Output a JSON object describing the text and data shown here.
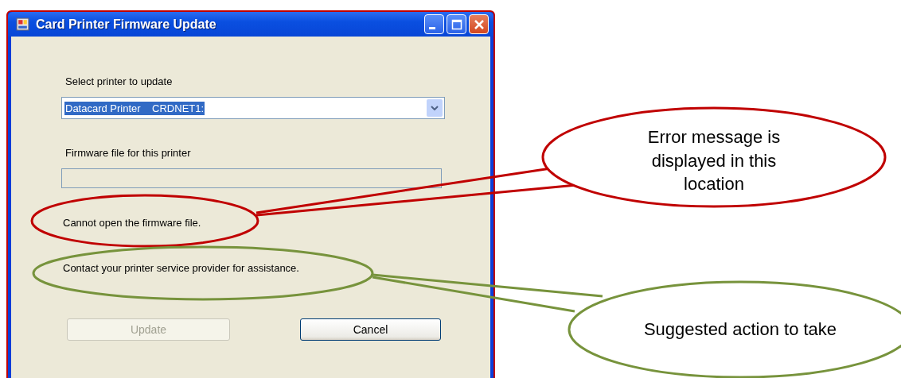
{
  "window": {
    "title": "Card Printer Firmware Update"
  },
  "printer": {
    "label": "Select printer to update",
    "value": "Datacard Printer    CRDNET1:",
    "highlighted": true
  },
  "firmware": {
    "label": "Firmware file for this printer"
  },
  "error_message": "Cannot open the firmware file.",
  "suggestion": "Contact your printer service provider for assistance.",
  "buttons": [
    {
      "label": "Update",
      "disabled": true
    },
    {
      "label": "Cancel",
      "disabled": false
    }
  ],
  "callouts": [
    {
      "text": "Error message is displayed in this location",
      "color": "#c00000"
    },
    {
      "text": "Suggested action to take",
      "color": "#77933c"
    }
  ]
}
